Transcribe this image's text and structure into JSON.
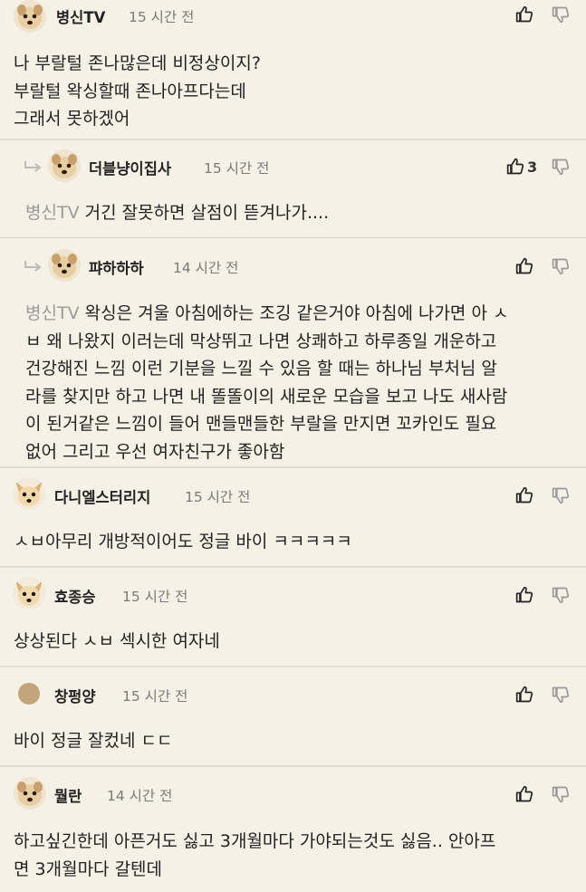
{
  "comments": [
    {
      "author": "병신TV",
      "time": "15 시간 전",
      "text": "나 부랄털 존나많은데 비정상이지?\n부랄털 왁싱할때 존나아프다는데\n그래서 못하겠어",
      "likes": ""
    },
    {
      "author": "더블냥이집사",
      "time": "15 시간 전",
      "mention": "병신TV",
      "text": " 거긴 잘못하면 살점이 뜯겨나가....",
      "likes": "3"
    },
    {
      "author": "퍄하하하",
      "time": "14 시간 전",
      "mention": "병신TV",
      "text": " 왁싱은 겨울 아침에하는 조깅 같은거야 아침에 나가면 아 ㅅ\nㅂ 왜 나왔지 이러는데 막상뛰고 나면 상쾌하고 하루종일 개운하고\n건강해진 느낌 이런 기분을 느낄 수 있음 할 때는 하나님 부처님 알\n라를 찾지만 하고 나면 내 똘똘이의 새로운 모습을 보고 나도 새사람\n이 된거같은 느낌이 들어 맨들맨들한 부랄을 만지면 꼬카인도 필요\n없어 그리고 우선 여자친구가 좋아함",
      "likes": ""
    },
    {
      "author": "다니엘스터리지",
      "time": "15 시간 전",
      "text": "ㅅㅂ아무리 개방적이어도 정글 바이 ㅋㅋㅋㅋㅋ",
      "likes": ""
    },
    {
      "author": "효종승",
      "time": "15 시간 전",
      "text": "상상된다 ㅅㅂ 섹시한 여자네",
      "likes": ""
    },
    {
      "author": "창펑양",
      "time": "15 시간 전",
      "text": "바이 정글 잘컸네 ㄷㄷ",
      "likes": ""
    },
    {
      "author": "뭘란",
      "time": "14 시간 전",
      "text": "하고싶긴한데 아픈거도 싫고 3개월마다 가야되는것도 싫음.. 안아프\n면 3개월마다 갈텐데",
      "likes": ""
    }
  ],
  "icons": {
    "like": "thumbs-up-icon",
    "dislike": "thumbs-down-icon",
    "reply": "reply-arrow-icon"
  },
  "colors": {
    "background": "#f6f1e6",
    "divider": "#e4ddcf",
    "mention": "#9a9a9a",
    "time": "#7a7a7a"
  }
}
